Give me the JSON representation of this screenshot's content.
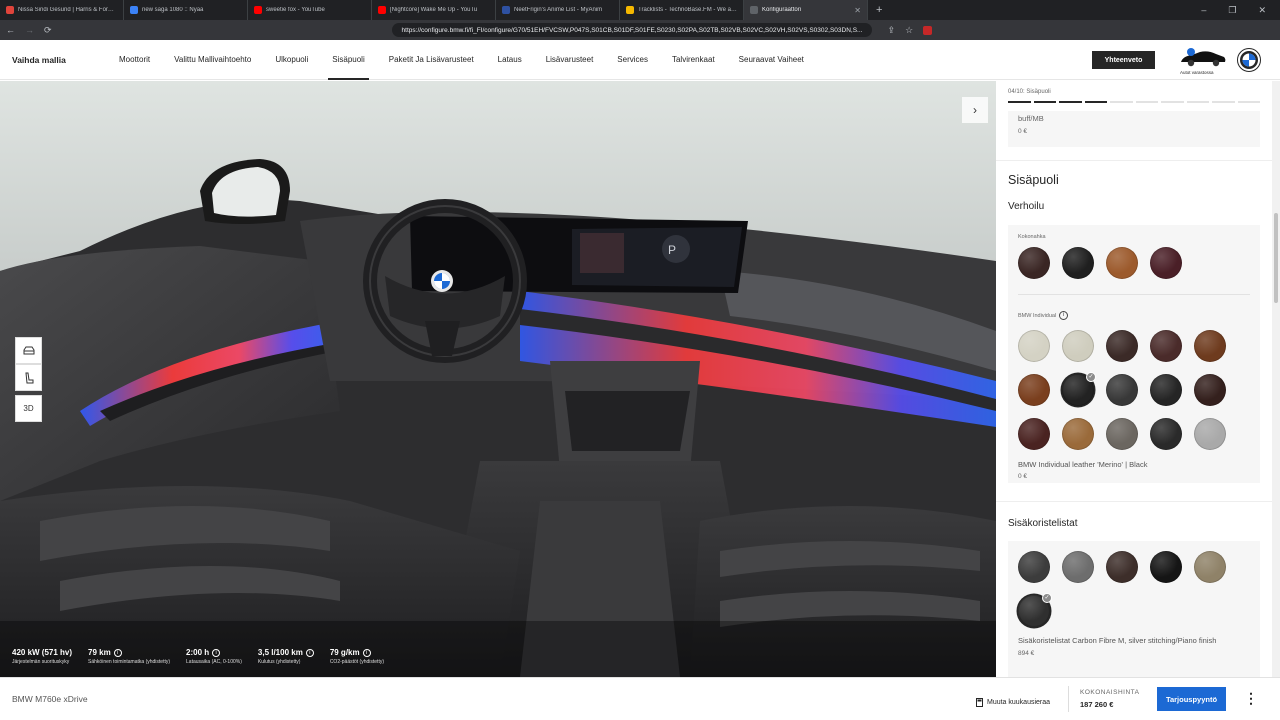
{
  "browser": {
    "tabs": [
      {
        "title": "Nissa Sindi Gesund | Harris & Ford R",
        "color": "#e0443b"
      },
      {
        "title": "new saga 1080 :: Nyaa",
        "color": "#3b82f6"
      },
      {
        "title": "sweetie fox - YouTube",
        "color": "#ff0000"
      },
      {
        "title": "[Nightcore] Wake Me Up - YouTu",
        "color": "#ff0000"
      },
      {
        "title": "NeetFrigin's Anime List - MyAnim",
        "color": "#2e51a2"
      },
      {
        "title": "Tracklists - TechnoBase.FM - We aRe",
        "color": "#f5b800"
      },
      {
        "title": "Konfiguraattori",
        "color": "#5f6368"
      }
    ],
    "url": "https://configure.bmw.fi/fi_FI/configure/G70/51EH/FVCSW,P047S,S01CB,S01DF,S01FE,S0230,S02PA,S02TB,S02VB,S02VC,S02VH,S02VS,S0302,S03DN,S..."
  },
  "nav": {
    "brand": "Vaihda mallia",
    "items": [
      "Moottorit",
      "Valittu Mallivaihtoehto",
      "Ulkopuoli",
      "Sisäpuoli",
      "Paketit Ja Lisävarusteet",
      "Lataus",
      "Lisävarusteet",
      "Services",
      "Talvirenkaat",
      "Seuraavat Vaiheet"
    ],
    "active": "Sisäpuoli",
    "summary_button": "Yhteenveto",
    "car_badge_label": "Autot varastossa"
  },
  "specs": [
    {
      "value": "420 kW (571 hv)",
      "label": "Järjestelmän suorituskyky"
    },
    {
      "value": "79 km",
      "label": "Sähköinen toimintamatka (yhdistetty)",
      "info": true
    },
    {
      "value": "2:00 h",
      "label": "Latausaika (AC, 0-100%)",
      "info": true
    },
    {
      "value": "3,5 l/100 km",
      "label": "Kulutus (yhdistetty)",
      "info": true
    },
    {
      "value": "79 g/km",
      "label": "CO2-päästöt (yhdistetty)",
      "info": true
    }
  ],
  "view_controls": [
    "car-front-icon",
    "seat-icon",
    "3D"
  ],
  "panel": {
    "step": "04/10: Sisäpuoli",
    "progress_done": 4,
    "progress_total": 10,
    "prev_name": "buff/MB",
    "prev_price": "0 €",
    "section_title": "Sisäpuoli",
    "upholstery": {
      "title": "Verhoilu",
      "group1_label": "Kokonahka",
      "group1": [
        "#3a2624",
        "#1f1f1f",
        "#9c5a2c",
        "#4a1f27"
      ],
      "group2_label": "BMW Individual",
      "group2": [
        "#d4d2c4",
        "#cfcdbe",
        "#3b2a27",
        "#4a2b2a",
        "#6e3b1e",
        "#7a3f1e",
        "#222222",
        "#383838",
        "#252525",
        "#34201d",
        "#4a2321",
        "#9a6a3a",
        "#6b6660",
        "#2a2a2a",
        "#a9a9a9"
      ],
      "selected_index": 6,
      "selected_name": "BMW Individual leather 'Merino' | Black",
      "selected_price": "0 €"
    },
    "trims": {
      "title": "Sisäkoristelistat",
      "swatches": [
        "#3c3c3c",
        "#6d6d6d",
        "#3d2e2a",
        "#151515",
        "#8f8268",
        "#2f2f2f"
      ],
      "selected_index": 5,
      "selected_name": "Sisäkoristelistat Carbon Fibre M, silver stitching/Piano finish",
      "selected_price": "894 €"
    }
  },
  "bottom": {
    "model": "BMW M760e xDrive",
    "change_payment": "Muuta kuukausieraa",
    "total_label": "KOKONAISHINTA",
    "total_value": "187 260 €",
    "offer_button": "Tarjouspyyntö"
  }
}
